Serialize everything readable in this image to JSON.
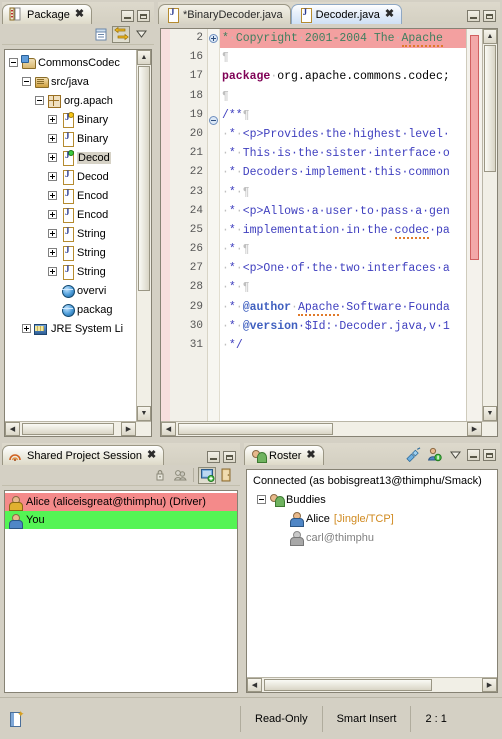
{
  "package_explorer": {
    "tab_label": "Package",
    "tab_icon": "package-explorer-icon",
    "toolbar": {
      "collapse_all": "collapse-all-icon",
      "link_with_editor": "link-with-editor-icon",
      "view_menu": "view-menu-icon"
    },
    "tree": [
      {
        "label": "CommonsCodec",
        "icon": "java-project-icon",
        "indent": 0,
        "expander": "minus",
        "selected": false
      },
      {
        "label": "src/java",
        "icon": "source-folder-icon",
        "indent": 1,
        "expander": "minus",
        "selected": false
      },
      {
        "label": "org.apach",
        "icon": "package-icon",
        "indent": 2,
        "expander": "minus",
        "selected": false
      },
      {
        "label": "Binary",
        "icon": "java-file-warn-icon",
        "indent": 3,
        "expander": "plus",
        "selected": false
      },
      {
        "label": "Binary",
        "icon": "java-file-icon",
        "indent": 3,
        "expander": "plus",
        "selected": false
      },
      {
        "label": "Decod",
        "icon": "java-file-ok-icon",
        "indent": 3,
        "expander": "plus",
        "selected": true
      },
      {
        "label": "Decod",
        "icon": "java-file-icon",
        "indent": 3,
        "expander": "plus",
        "selected": false
      },
      {
        "label": "Encod",
        "icon": "java-file-icon",
        "indent": 3,
        "expander": "plus",
        "selected": false
      },
      {
        "label": "Encod",
        "icon": "java-file-icon",
        "indent": 3,
        "expander": "plus",
        "selected": false
      },
      {
        "label": "String",
        "icon": "java-file-icon",
        "indent": 3,
        "expander": "plus",
        "selected": false
      },
      {
        "label": "String",
        "icon": "java-file-icon",
        "indent": 3,
        "expander": "plus",
        "selected": false
      },
      {
        "label": "String",
        "icon": "java-file-icon",
        "indent": 3,
        "expander": "plus",
        "selected": false
      },
      {
        "label": "overvi",
        "icon": "html-file-icon",
        "indent": 3,
        "expander": "none",
        "selected": false
      },
      {
        "label": "packag",
        "icon": "html-file-icon",
        "indent": 3,
        "expander": "none",
        "selected": false
      },
      {
        "label": "JRE System Li",
        "icon": "jre-library-icon",
        "indent": 1,
        "expander": "plus",
        "selected": false
      }
    ]
  },
  "editor": {
    "tabs": [
      {
        "label": "*BinaryDecoder.java",
        "active": false,
        "dirty": true,
        "closable": false
      },
      {
        "label": "Decoder.java",
        "active": true,
        "dirty": false,
        "closable": true
      }
    ],
    "minimize_label": "minimize-icon",
    "maximize_label": "maximize-icon",
    "lines": [
      {
        "num": "2",
        "fold": "plus",
        "highlight": true,
        "segments": [
          {
            "t": "*",
            "c": "cmt"
          },
          {
            "t": "·",
            "c": "ws"
          },
          {
            "t": "Copyright",
            "c": "cmt"
          },
          {
            "t": "·",
            "c": "ws"
          },
          {
            "t": "2001-2004",
            "c": "cmt"
          },
          {
            "t": "·",
            "c": "ws"
          },
          {
            "t": "The",
            "c": "cmt"
          },
          {
            "t": "·",
            "c": "ws"
          },
          {
            "t": "Apache",
            "c": "cmt spell"
          }
        ]
      },
      {
        "num": "16",
        "fold": "",
        "highlight": false,
        "segments": [
          {
            "t": "¶",
            "c": "ws"
          }
        ]
      },
      {
        "num": "17",
        "fold": "",
        "highlight": false,
        "segments": [
          {
            "t": "package",
            "c": "kw"
          },
          {
            "t": "·",
            "c": "ws"
          },
          {
            "t": "org.apache.commons.codec;",
            "c": ""
          }
        ]
      },
      {
        "num": "18",
        "fold": "",
        "highlight": false,
        "segments": [
          {
            "t": "¶",
            "c": "ws"
          }
        ]
      },
      {
        "num": "19",
        "fold": "minus",
        "highlight": false,
        "segments": [
          {
            "t": "/**",
            "c": "jd"
          },
          {
            "t": "¶",
            "c": "ws"
          }
        ]
      },
      {
        "num": "20",
        "fold": "",
        "highlight": false,
        "segments": [
          {
            "t": "·",
            "c": "ws"
          },
          {
            "t": "*",
            "c": "jd"
          },
          {
            "t": "·",
            "c": "ws"
          },
          {
            "t": "<p>Provides·the·highest·level·",
            "c": "jd"
          }
        ]
      },
      {
        "num": "21",
        "fold": "",
        "highlight": false,
        "segments": [
          {
            "t": "·",
            "c": "ws"
          },
          {
            "t": "*",
            "c": "jd"
          },
          {
            "t": "·",
            "c": "ws"
          },
          {
            "t": "This·is·the·sister·interface·o",
            "c": "jd"
          }
        ]
      },
      {
        "num": "22",
        "fold": "",
        "highlight": false,
        "segments": [
          {
            "t": "·",
            "c": "ws"
          },
          {
            "t": "*",
            "c": "jd"
          },
          {
            "t": "·",
            "c": "ws"
          },
          {
            "t": "Decoders·implement·this·common",
            "c": "jd"
          }
        ]
      },
      {
        "num": "23",
        "fold": "",
        "highlight": false,
        "segments": [
          {
            "t": "·",
            "c": "ws"
          },
          {
            "t": "*",
            "c": "jd"
          },
          {
            "t": "·¶",
            "c": "ws"
          }
        ]
      },
      {
        "num": "24",
        "fold": "",
        "highlight": false,
        "segments": [
          {
            "t": "·",
            "c": "ws"
          },
          {
            "t": "*",
            "c": "jd"
          },
          {
            "t": "·",
            "c": "ws"
          },
          {
            "t": "<p>Allows·a·user·to·pass·a·gen",
            "c": "jd"
          }
        ]
      },
      {
        "num": "25",
        "fold": "",
        "highlight": false,
        "segments": [
          {
            "t": "·",
            "c": "ws"
          },
          {
            "t": "*",
            "c": "jd"
          },
          {
            "t": "·",
            "c": "ws"
          },
          {
            "t": "implementation·in·the·",
            "c": "jd"
          },
          {
            "t": "codec",
            "c": "jd spell"
          },
          {
            "t": "·pa",
            "c": "jd"
          }
        ]
      },
      {
        "num": "26",
        "fold": "",
        "highlight": false,
        "segments": [
          {
            "t": "·",
            "c": "ws"
          },
          {
            "t": "*",
            "c": "jd"
          },
          {
            "t": "·¶",
            "c": "ws"
          }
        ]
      },
      {
        "num": "27",
        "fold": "",
        "highlight": false,
        "segments": [
          {
            "t": "·",
            "c": "ws"
          },
          {
            "t": "*",
            "c": "jd"
          },
          {
            "t": "·",
            "c": "ws"
          },
          {
            "t": "<p>One·of·the·two·interfaces·a",
            "c": "jd"
          }
        ]
      },
      {
        "num": "28",
        "fold": "",
        "highlight": false,
        "segments": [
          {
            "t": "·",
            "c": "ws"
          },
          {
            "t": "*",
            "c": "jd"
          },
          {
            "t": "·¶",
            "c": "ws"
          }
        ]
      },
      {
        "num": "29",
        "fold": "",
        "highlight": false,
        "segments": [
          {
            "t": "·",
            "c": "ws"
          },
          {
            "t": "*",
            "c": "jd"
          },
          {
            "t": "·",
            "c": "ws"
          },
          {
            "t": "@author",
            "c": "jdb"
          },
          {
            "t": "·",
            "c": "ws"
          },
          {
            "t": "Apache",
            "c": "jd spell"
          },
          {
            "t": "·Software·Founda",
            "c": "jd"
          }
        ]
      },
      {
        "num": "30",
        "fold": "",
        "highlight": false,
        "segments": [
          {
            "t": "·",
            "c": "ws"
          },
          {
            "t": "*",
            "c": "jd"
          },
          {
            "t": "·",
            "c": "ws"
          },
          {
            "t": "@version",
            "c": "jdb"
          },
          {
            "t": "·$Id:·Decoder.java,v·1",
            "c": "jd"
          }
        ]
      },
      {
        "num": "31",
        "fold": "",
        "highlight": false,
        "segments": [
          {
            "t": "·",
            "c": "ws"
          },
          {
            "t": "*",
            "c": "jd"
          },
          {
            "t": "/",
            "c": "jd"
          }
        ]
      }
    ]
  },
  "session": {
    "tab_label": "Shared Project Session",
    "tab_icon": "saros-session-icon",
    "toolbar": {
      "give_exclusive_driver_role": "driver-role-icon",
      "follow_mode": "follow-mode-icon",
      "share_project": "share-project-icon",
      "leave_session": "leave-session-icon"
    },
    "participants": [
      {
        "label": "Alice (aliceisgreat@thimphu) (Driver)",
        "role": "driver",
        "icon": "user-driver-icon"
      },
      {
        "label": "You",
        "role": "you",
        "icon": "user-icon"
      }
    ]
  },
  "roster": {
    "tab_label": "Roster",
    "tab_icon": "roster-icon",
    "toolbar": {
      "connect": "connect-icon",
      "add_contact": "add-contact-icon",
      "view_menu": "view-menu-icon",
      "minimize": "minimize-icon",
      "maximize": "maximize-icon"
    },
    "connection_status": "Connected (as bobisgreat13@thimphu/Smack)",
    "tree": [
      {
        "label": "Buddies",
        "icon": "buddies-group-icon",
        "indent": 0,
        "expander": "minus",
        "suffix": "",
        "muted": false
      },
      {
        "label": "Alice",
        "icon": "contact-online-icon",
        "indent": 1,
        "expander": "none",
        "suffix": "[Jingle/TCP]",
        "muted": false
      },
      {
        "label": "carl@thimphu",
        "icon": "contact-offline-icon",
        "indent": 1,
        "expander": "none",
        "suffix": "",
        "muted": true
      }
    ]
  },
  "statusbar": {
    "save_icon": "save-status-icon",
    "cells": [
      "Read-Only",
      "Smart Insert",
      "2 : 1"
    ]
  },
  "colors": {
    "driver_highlight": "#f48a8a",
    "you_highlight": "#54f454",
    "keyword": "#7f0055",
    "javadoc": "#3f3fbf",
    "comment": "#3f7f5f",
    "chrome": "#d4d0c4"
  }
}
